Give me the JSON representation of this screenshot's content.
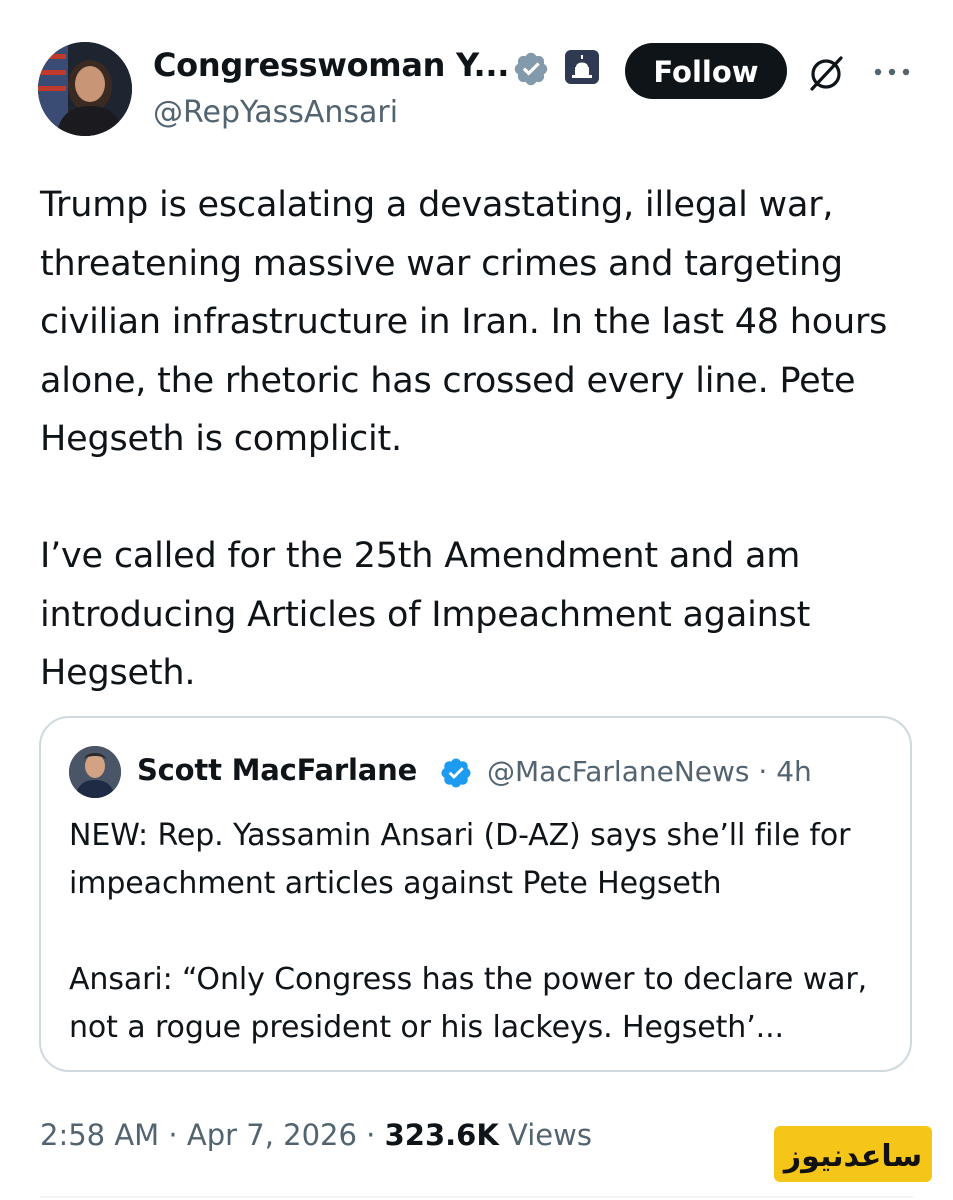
{
  "author": {
    "display_name": "Congresswoman Y...",
    "handle": "@RepYassAnsari"
  },
  "actions": {
    "follow_label": "Follow"
  },
  "tweet": {
    "paragraphs": [
      "Trump is escalating a devastating, illegal war, threatening massive war crimes and targeting civilian infrastructure in Iran. In the last 48 hours alone, the rhetoric has crossed every line. Pete Hegseth is complicit.",
      "I’ve called for the 25th Amendment and am introducing Articles of Impeachment against Hegseth."
    ]
  },
  "quote": {
    "display_name": "Scott MacFarlane",
    "handle": "@MacFarlaneNews",
    "separator": "·",
    "time_ago": "4h",
    "paragraphs": [
      "NEW:  Rep. Yassamin Ansari (D-AZ) says she’ll file for impeachment articles against Pete Hegseth",
      "Ansari: “Only Congress has the power to declare war, not a rogue president or his lackeys. Hegseth’..."
    ]
  },
  "footer": {
    "time": "2:58 AM",
    "sep1": "·",
    "date": "Apr 7, 2026",
    "sep2": "·",
    "views_count": "323.6K",
    "views_label": "Views"
  },
  "watermark": {
    "text": "ساعدنیوز"
  },
  "icons": {
    "verified": "verified-badge-icon",
    "government": "capitol-icon",
    "grok": "grok-icon",
    "more": "more-icon"
  },
  "colors": {
    "text_primary": "#0f1419",
    "text_secondary": "#536471",
    "verified_blue": "#1d9bf0",
    "verified_gray": "#829aab",
    "follow_bg": "#0f1419",
    "border": "#cfd9de",
    "watermark_bg": "#f5c518"
  }
}
